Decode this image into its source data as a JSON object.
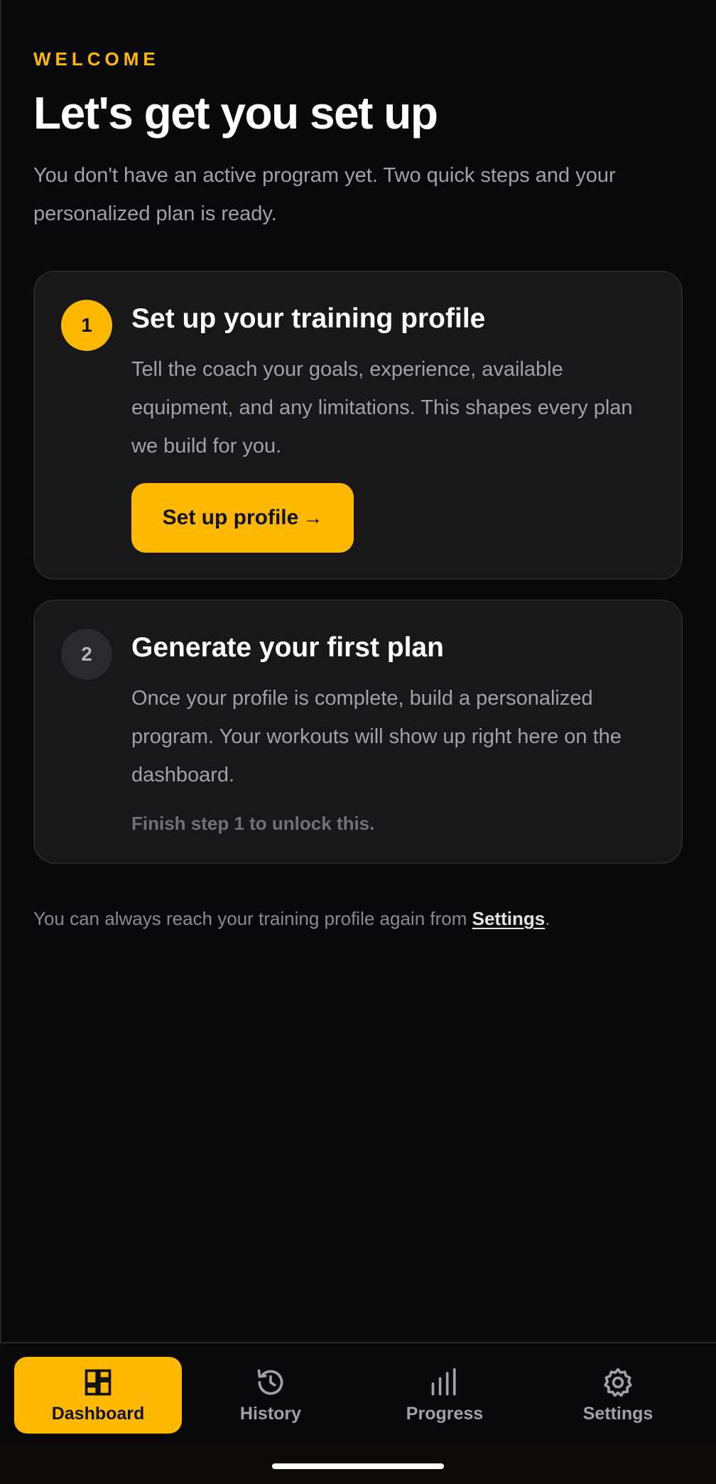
{
  "header": {
    "eyebrow": "WELCOME",
    "title": "Let's get you set up",
    "intro": "You don't have an active program yet. Two quick steps and your personalized plan is ready."
  },
  "steps": [
    {
      "number": "1",
      "title": "Set up your training profile",
      "description": "Tell the coach your goals, experience, available equipment, and any limitations. This shapes every plan we build for you.",
      "button_label": "Set up profile",
      "button_arrow": "→",
      "status": "active"
    },
    {
      "number": "2",
      "title": "Generate your first plan",
      "description": "Once your profile is complete, build a personalized program. Your workouts will show up right here on the dashboard.",
      "locked_note": "Finish step 1 to unlock this.",
      "status": "locked"
    }
  ],
  "footnote": {
    "prefix": "You can always reach your training profile again from ",
    "link": "Settings",
    "suffix": "."
  },
  "nav": {
    "items": [
      {
        "label": "Dashboard",
        "icon": "dashboard-icon",
        "active": true
      },
      {
        "label": "History",
        "icon": "history-icon",
        "active": false
      },
      {
        "label": "Progress",
        "icon": "bar-chart-icon",
        "active": false
      },
      {
        "label": "Settings",
        "icon": "gear-icon",
        "active": false
      }
    ]
  },
  "colors": {
    "accent": "#ffb800",
    "background": "#09090b",
    "card": "#18181b",
    "muted_text": "#a1a1aa"
  }
}
